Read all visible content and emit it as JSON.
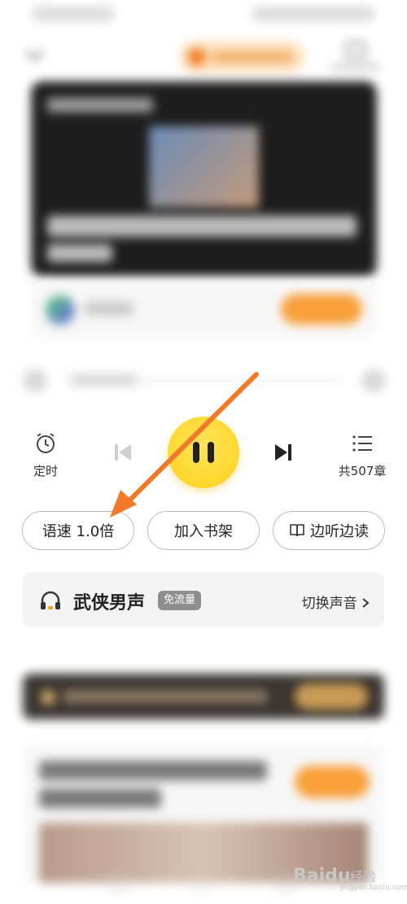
{
  "controls": {
    "timer_label": "定时",
    "chapters_label": "共507章"
  },
  "actions": {
    "speed_label": "语速 1.0倍",
    "add_shelf_label": "加入书架",
    "listen_read_label": "边听边读"
  },
  "voice": {
    "name": "武侠男声",
    "badge": "免流量",
    "switch_label": "切换声音"
  },
  "watermark": {
    "brand": "Baidu",
    "suffix": "经验",
    "url": "jingyan.baidu.com"
  },
  "colors": {
    "play_button": "#ffd21a",
    "accent_orange": "#f8a03a",
    "annotation_arrow": "#f07a2a"
  }
}
